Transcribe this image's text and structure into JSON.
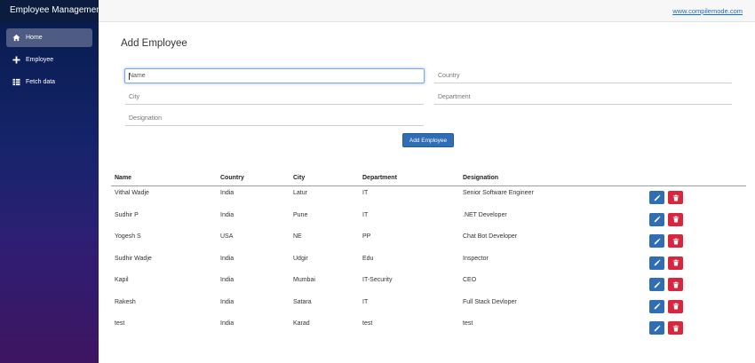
{
  "sidebar": {
    "brand": "Employee Management",
    "items": [
      {
        "label": "Home",
        "icon": "home-icon",
        "active": true
      },
      {
        "label": "Employee",
        "icon": "plus-icon",
        "active": false
      },
      {
        "label": "Fetch data",
        "icon": "list-icon",
        "active": false
      }
    ]
  },
  "topbar": {
    "link": "www.compilemode.com"
  },
  "form": {
    "title": "Add Employee",
    "name_placeholder": "Name",
    "country_placeholder": "Country",
    "city_placeholder": "City",
    "department_placeholder": "Department",
    "designation_placeholder": "Designation",
    "submit_label": "Add Employee"
  },
  "table": {
    "headers": [
      "Name",
      "Country",
      "City",
      "Department",
      "Designation"
    ],
    "rows": [
      [
        "Vithal Wadje",
        "India",
        "Latur",
        "IT",
        "Senior Software Engineer"
      ],
      [
        "Sudhir P",
        "India",
        "Pune",
        "IT",
        ".NET Developer"
      ],
      [
        "Yogesh S",
        "USA",
        "NE",
        "PP",
        "Chat Bot Developer"
      ],
      [
        "Sudhir Wadje",
        "India",
        "Udgir",
        "Edu",
        "Inspector"
      ],
      [
        "Kapil",
        "India",
        "Mumbai",
        "IT-Security",
        "CEO"
      ],
      [
        "Rakesh",
        "India",
        "Satara",
        "IT",
        "Full Stack Devloper"
      ],
      [
        "test",
        "India",
        "Karad",
        "test",
        "test"
      ]
    ]
  },
  "colors": {
    "primary": "#2f6db5",
    "danger": "#d7263d",
    "sidebar_top": "#071b4b"
  }
}
